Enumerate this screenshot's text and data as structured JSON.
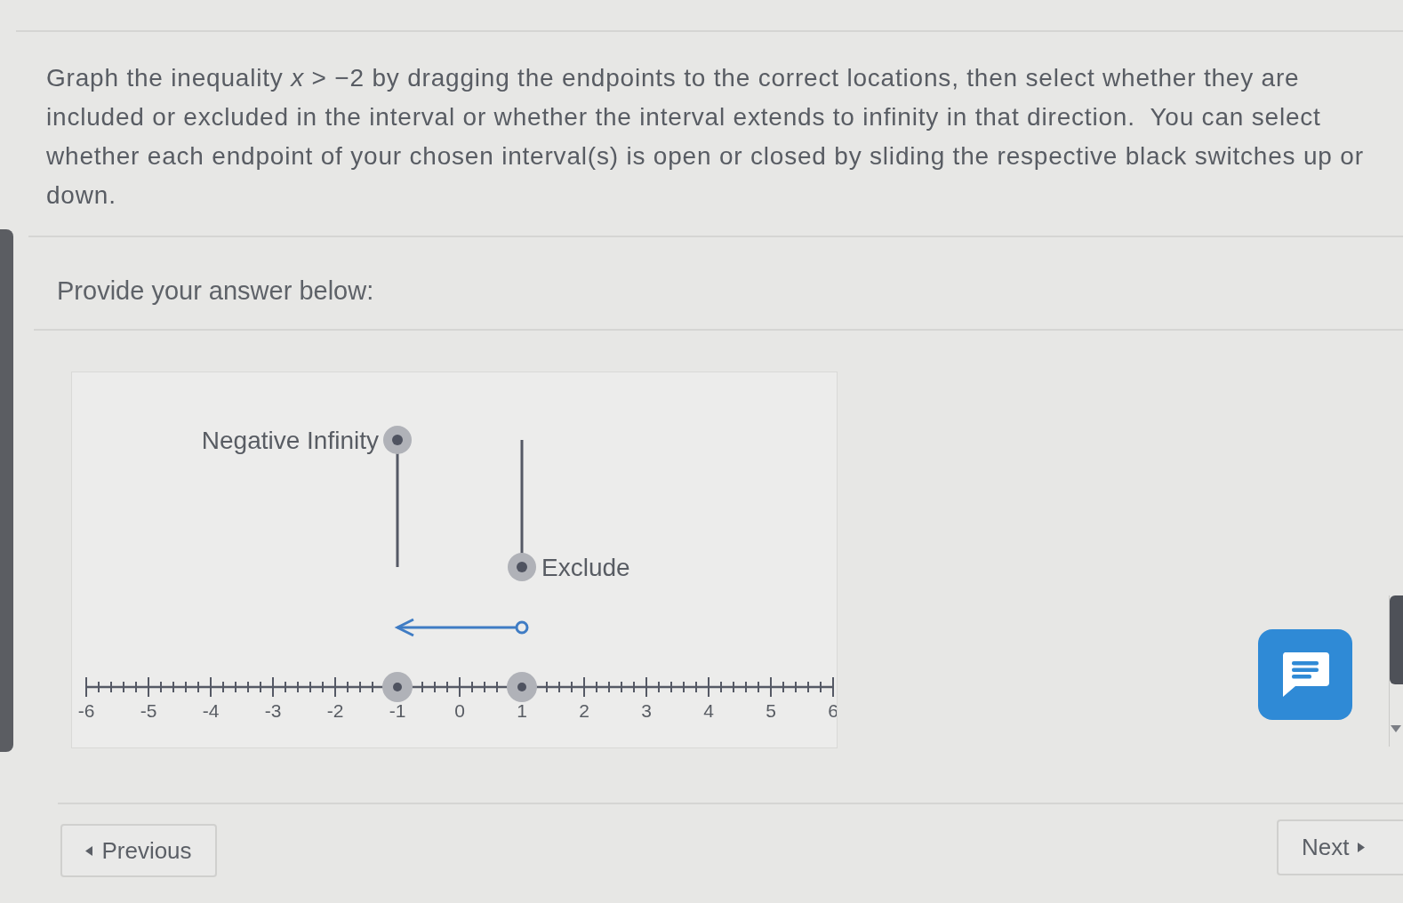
{
  "question": {
    "text": "Graph the inequality *x* > −2 by dragging the endpoints to the correct locations, then select whether they are included or excluded in the interval or whether the interval extends to infinity in that direction.  You can select whether each endpoint of your chosen interval(s) is open or closed by sliding the respective black switches up or down."
  },
  "prompt": "Provide your answer below:",
  "graph": {
    "switches": [
      {
        "label": "Negative Infinity",
        "up": true
      },
      {
        "label": "Exclude",
        "up": false
      }
    ],
    "interval": {
      "left_infinite": true,
      "right_open": true
    },
    "number_line": {
      "ticks": [
        {
          "label": "-6",
          "handle": false
        },
        {
          "label": "-5",
          "handle": false
        },
        {
          "label": "-4",
          "handle": false
        },
        {
          "label": "-3",
          "handle": false
        },
        {
          "label": "-2",
          "handle": false
        },
        {
          "label": "-1",
          "handle": true
        },
        {
          "label": "0",
          "handle": false
        },
        {
          "label": "1",
          "handle": true
        },
        {
          "label": "2",
          "handle": false
        },
        {
          "label": "3",
          "handle": false
        },
        {
          "label": "4",
          "handle": false
        },
        {
          "label": "5",
          "handle": false
        },
        {
          "label": "6",
          "handle": false
        }
      ]
    }
  },
  "navigation": {
    "previous": "Previous",
    "next": "Next"
  }
}
